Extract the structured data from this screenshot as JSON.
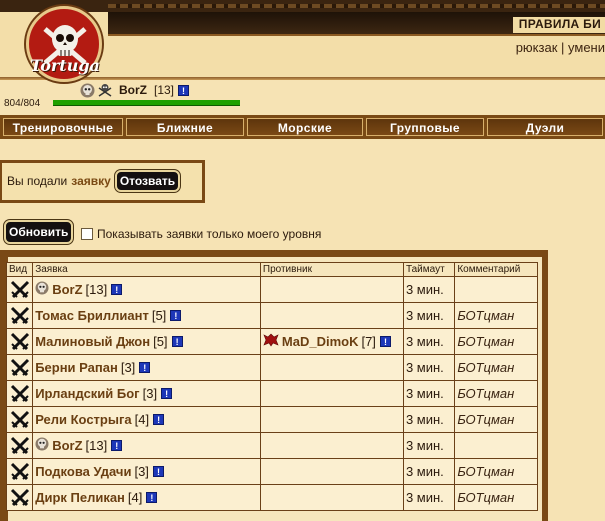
{
  "header": {
    "logo_text": "Tortuga",
    "top_menu": "ПРАВИЛА БИ",
    "user_menu": {
      "backpack": "рюкзак",
      "separator": "|",
      "skills": "умени"
    }
  },
  "player": {
    "name": "BorZ",
    "level": "[13]",
    "hp_text": "804/804",
    "hp_fraction": 1.0
  },
  "tabs": [
    "Тренировочные",
    "Ближние",
    "Морские",
    "Групповые",
    "Дуэли"
  ],
  "application": {
    "text": "Вы подали",
    "link": "заявку",
    "revoke_label": "Отозвать"
  },
  "refresh_label": "Обновить",
  "level_filter_label": "Показывать заявки только моего уровня",
  "table": {
    "headers": [
      "Вид",
      "Заявка",
      "Противник",
      "Таймаут",
      "Комментарий"
    ],
    "rows": [
      {
        "name": "BorZ",
        "level": "[13]",
        "skull": true,
        "opponent": "",
        "opponent_level": "",
        "timeout": "3 мин.",
        "comment": ""
      },
      {
        "name": "Томас Бриллиант",
        "level": "[5]",
        "skull": false,
        "opponent": "",
        "opponent_level": "",
        "timeout": "3 мин.",
        "comment": "БОТцман"
      },
      {
        "name": "Малиновый Джон",
        "level": "[5]",
        "skull": false,
        "opponent": "MaD_DimoK",
        "opponent_level": "[7]",
        "timeout": "3 мин.",
        "comment": "БОТцман"
      },
      {
        "name": "Берни Рапан",
        "level": "[3]",
        "skull": false,
        "opponent": "",
        "opponent_level": "",
        "timeout": "3 мин.",
        "comment": "БОТцман"
      },
      {
        "name": "Ирландский Бог",
        "level": "[3]",
        "skull": false,
        "opponent": "",
        "opponent_level": "",
        "timeout": "3 мин.",
        "comment": "БОТцман"
      },
      {
        "name": "Рели Кострыга",
        "level": "[4]",
        "skull": false,
        "opponent": "",
        "opponent_level": "",
        "timeout": "3 мин.",
        "comment": "БОТцман"
      },
      {
        "name": "BorZ",
        "level": "[13]",
        "skull": true,
        "opponent": "",
        "opponent_level": "",
        "timeout": "3 мин.",
        "comment": ""
      },
      {
        "name": "Подкова Удачи",
        "level": "[3]",
        "skull": false,
        "opponent": "",
        "opponent_level": "",
        "timeout": "3 мин.",
        "comment": "БОТцман"
      },
      {
        "name": "Дирк Пеликан",
        "level": "[4]",
        "skull": false,
        "opponent": "",
        "opponent_level": "",
        "timeout": "3 мин.",
        "comment": "БОТцман"
      }
    ]
  },
  "icons": {
    "skull": "skull-icon",
    "swords": "crossed-swords-icon",
    "info": "info-icon",
    "crest": "red-crest-icon"
  },
  "colors": {
    "tab_bg": "#7a4915",
    "hp": "#1fa000",
    "name": "#6a3f12",
    "info": "#1d37b8"
  }
}
